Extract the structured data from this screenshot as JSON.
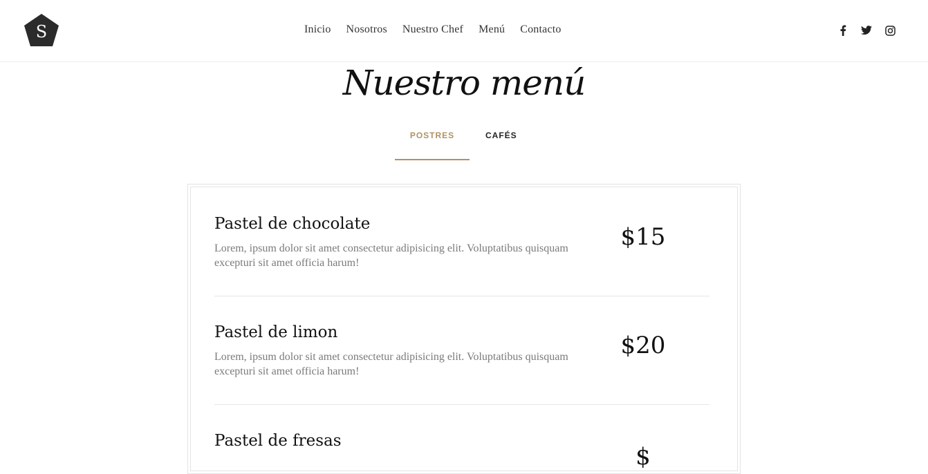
{
  "brand": {
    "logo_letter": "S",
    "logo_color": "#2b2b2b"
  },
  "nav": {
    "items": [
      {
        "label": "Inicio"
      },
      {
        "label": "Nosotros"
      },
      {
        "label": "Nuestro Chef"
      },
      {
        "label": "Menú"
      },
      {
        "label": "Contacto"
      }
    ]
  },
  "social": {
    "icons": [
      "facebook-icon",
      "twitter-icon",
      "instagram-icon"
    ]
  },
  "page": {
    "title": "Nuestro menú"
  },
  "tabs": [
    {
      "label": "POSTRES",
      "active": true
    },
    {
      "label": "CAFÉS",
      "active": false
    }
  ],
  "accent_color": "#b09260",
  "menu": {
    "items": [
      {
        "name": "Pastel de chocolate",
        "description": "Lorem, ipsum dolor sit amet consectetur adipisicing elit. Voluptatibus quisquam excepturi sit amet officia harum!",
        "price": "$15"
      },
      {
        "name": "Pastel de limon",
        "description": "Lorem, ipsum dolor sit amet consectetur adipisicing elit. Voluptatibus quisquam excepturi sit amet officia harum!",
        "price": "$20"
      },
      {
        "name": "Pastel de fresas",
        "description": "",
        "price": "$"
      }
    ]
  }
}
